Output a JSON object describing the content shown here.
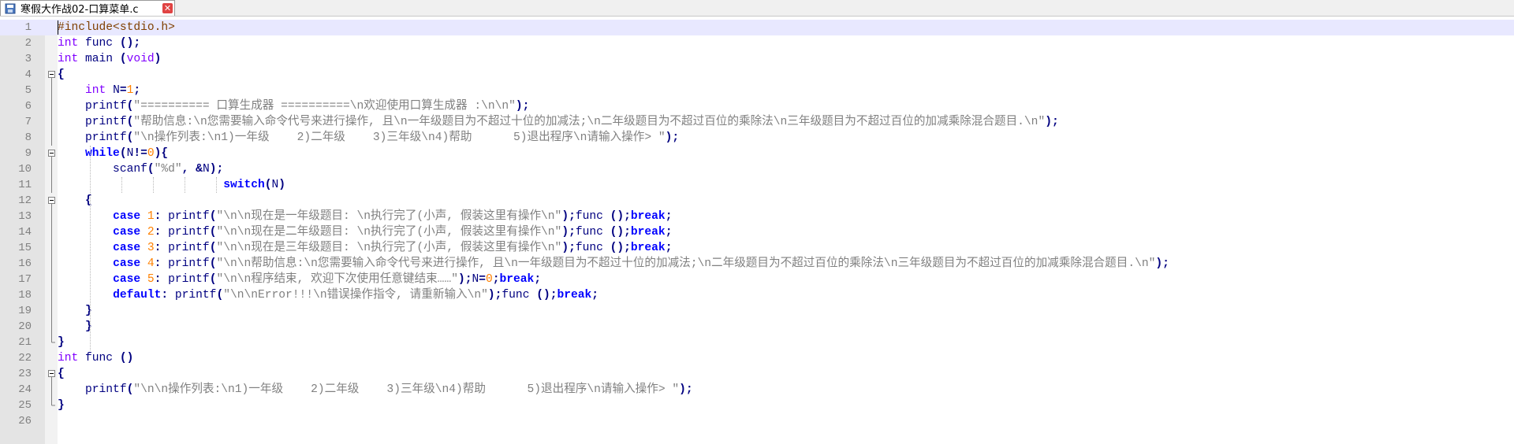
{
  "tab": {
    "title": "寒假大作战02-口算菜单.c",
    "icon": "save-file-icon",
    "close_icon": "close-icon"
  },
  "lines": [
    {
      "n": "1",
      "tokens": [
        {
          "t": "#include<stdio.h>",
          "c": "pp"
        }
      ]
    },
    {
      "n": "2",
      "tokens": [
        {
          "t": "int",
          "c": "ty"
        },
        {
          "t": " func ",
          "c": ""
        },
        {
          "t": "();",
          "c": "op"
        }
      ]
    },
    {
      "n": "3",
      "tokens": [
        {
          "t": "int",
          "c": "ty"
        },
        {
          "t": " main ",
          "c": ""
        },
        {
          "t": "(",
          "c": "op"
        },
        {
          "t": "void",
          "c": "ty"
        },
        {
          "t": ")",
          "c": "op"
        }
      ]
    },
    {
      "n": "4",
      "tokens": [
        {
          "t": "{",
          "c": "op"
        }
      ]
    },
    {
      "n": "5",
      "tokens": [
        {
          "t": "    ",
          "c": ""
        },
        {
          "t": "int",
          "c": "ty"
        },
        {
          "t": " N",
          "c": ""
        },
        {
          "t": "=",
          "c": "op"
        },
        {
          "t": "1",
          "c": "num"
        },
        {
          "t": ";",
          "c": "op"
        }
      ]
    },
    {
      "n": "6",
      "tokens": [
        {
          "t": "    printf",
          "c": ""
        },
        {
          "t": "(",
          "c": "op"
        },
        {
          "t": "\"========== 口算生成器 ==========\\n欢迎使用口算生成器 :\\n\\n\"",
          "c": "str"
        },
        {
          "t": ");",
          "c": "op"
        }
      ]
    },
    {
      "n": "7",
      "tokens": [
        {
          "t": "    printf",
          "c": ""
        },
        {
          "t": "(",
          "c": "op"
        },
        {
          "t": "\"帮助信息:\\n您需要输入命令代号来进行操作, 且\\n一年级题目为不超过十位的加减法;\\n二年级题目为不超过百位的乘除法\\n三年级题目为不超过百位的加减乘除混合题目.\\n\"",
          "c": "str"
        },
        {
          "t": ");",
          "c": "op"
        }
      ]
    },
    {
      "n": "8",
      "tokens": [
        {
          "t": "    printf",
          "c": ""
        },
        {
          "t": "(",
          "c": "op"
        },
        {
          "t": "\"\\n操作列表:\\n1)一年级    2)二年级    3)三年级\\n4)帮助      5)退出程序\\n请输入操作> \"",
          "c": "str"
        },
        {
          "t": ");",
          "c": "op"
        }
      ]
    },
    {
      "n": "9",
      "tokens": [
        {
          "t": "    ",
          "c": ""
        },
        {
          "t": "while",
          "c": "kw"
        },
        {
          "t": "(",
          "c": "op"
        },
        {
          "t": "N",
          "c": ""
        },
        {
          "t": "!=",
          "c": "op"
        },
        {
          "t": "0",
          "c": "num"
        },
        {
          "t": "){",
          "c": "op"
        }
      ]
    },
    {
      "n": "10",
      "tokens": [
        {
          "t": "        scanf",
          "c": ""
        },
        {
          "t": "(",
          "c": "op"
        },
        {
          "t": "\"%d\"",
          "c": "str"
        },
        {
          "t": ", &",
          "c": "op"
        },
        {
          "t": "N",
          "c": ""
        },
        {
          "t": ");",
          "c": "op"
        }
      ]
    },
    {
      "n": "11",
      "tokens": [
        {
          "t": "                        ",
          "c": ""
        },
        {
          "t": "switch",
          "c": "kw"
        },
        {
          "t": "(",
          "c": "op"
        },
        {
          "t": "N",
          "c": ""
        },
        {
          "t": ")",
          "c": "op"
        }
      ]
    },
    {
      "n": "12",
      "tokens": [
        {
          "t": "    ",
          "c": ""
        },
        {
          "t": "{",
          "c": "op"
        }
      ]
    },
    {
      "n": "13",
      "tokens": [
        {
          "t": "        ",
          "c": ""
        },
        {
          "t": "case",
          "c": "kw"
        },
        {
          "t": " ",
          "c": ""
        },
        {
          "t": "1",
          "c": "num"
        },
        {
          "t": ":",
          "c": "op"
        },
        {
          "t": " printf",
          "c": ""
        },
        {
          "t": "(",
          "c": "op"
        },
        {
          "t": "\"\\n\\n现在是一年级题目: \\n执行完了(小声, 假装这里有操作\\n\"",
          "c": "str"
        },
        {
          "t": ");",
          "c": "op"
        },
        {
          "t": "func ",
          "c": ""
        },
        {
          "t": "();",
          "c": "op"
        },
        {
          "t": "break",
          "c": "kw"
        },
        {
          "t": ";",
          "c": "op"
        }
      ]
    },
    {
      "n": "14",
      "tokens": [
        {
          "t": "        ",
          "c": ""
        },
        {
          "t": "case",
          "c": "kw"
        },
        {
          "t": " ",
          "c": ""
        },
        {
          "t": "2",
          "c": "num"
        },
        {
          "t": ":",
          "c": "op"
        },
        {
          "t": " printf",
          "c": ""
        },
        {
          "t": "(",
          "c": "op"
        },
        {
          "t": "\"\\n\\n现在是二年级题目: \\n执行完了(小声, 假装这里有操作\\n\"",
          "c": "str"
        },
        {
          "t": ");",
          "c": "op"
        },
        {
          "t": "func ",
          "c": ""
        },
        {
          "t": "();",
          "c": "op"
        },
        {
          "t": "break",
          "c": "kw"
        },
        {
          "t": ";",
          "c": "op"
        }
      ]
    },
    {
      "n": "15",
      "tokens": [
        {
          "t": "        ",
          "c": ""
        },
        {
          "t": "case",
          "c": "kw"
        },
        {
          "t": " ",
          "c": ""
        },
        {
          "t": "3",
          "c": "num"
        },
        {
          "t": ":",
          "c": "op"
        },
        {
          "t": " printf",
          "c": ""
        },
        {
          "t": "(",
          "c": "op"
        },
        {
          "t": "\"\\n\\n现在是三年级题目: \\n执行完了(小声, 假装这里有操作\\n\"",
          "c": "str"
        },
        {
          "t": ");",
          "c": "op"
        },
        {
          "t": "func ",
          "c": ""
        },
        {
          "t": "();",
          "c": "op"
        },
        {
          "t": "break",
          "c": "kw"
        },
        {
          "t": ";",
          "c": "op"
        }
      ]
    },
    {
      "n": "16",
      "tokens": [
        {
          "t": "        ",
          "c": ""
        },
        {
          "t": "case",
          "c": "kw"
        },
        {
          "t": " ",
          "c": ""
        },
        {
          "t": "4",
          "c": "num"
        },
        {
          "t": ":",
          "c": "op"
        },
        {
          "t": " printf",
          "c": ""
        },
        {
          "t": "(",
          "c": "op"
        },
        {
          "t": "\"\\n\\n帮助信息:\\n您需要输入命令代号来进行操作, 且\\n一年级题目为不超过十位的加减法;\\n二年级题目为不超过百位的乘除法\\n三年级题目为不超过百位的加减乘除混合题目.\\n\"",
          "c": "str"
        },
        {
          "t": ");",
          "c": "op"
        }
      ]
    },
    {
      "n": "17",
      "tokens": [
        {
          "t": "        ",
          "c": ""
        },
        {
          "t": "case",
          "c": "kw"
        },
        {
          "t": " ",
          "c": ""
        },
        {
          "t": "5",
          "c": "num"
        },
        {
          "t": ":",
          "c": "op"
        },
        {
          "t": " printf",
          "c": ""
        },
        {
          "t": "(",
          "c": "op"
        },
        {
          "t": "\"\\n\\n程序结束, 欢迎下次使用任意键结束……\"",
          "c": "str"
        },
        {
          "t": ");",
          "c": "op"
        },
        {
          "t": "N",
          "c": ""
        },
        {
          "t": "=",
          "c": "op"
        },
        {
          "t": "0",
          "c": "num"
        },
        {
          "t": ";",
          "c": "op"
        },
        {
          "t": "break",
          "c": "kw"
        },
        {
          "t": ";",
          "c": "op"
        }
      ]
    },
    {
      "n": "18",
      "tokens": [
        {
          "t": "        ",
          "c": ""
        },
        {
          "t": "default",
          "c": "kw"
        },
        {
          "t": ":",
          "c": "op"
        },
        {
          "t": " printf",
          "c": ""
        },
        {
          "t": "(",
          "c": "op"
        },
        {
          "t": "\"\\n\\nError!!!\\n错误操作指令, 请重新输入\\n\"",
          "c": "str"
        },
        {
          "t": ");",
          "c": "op"
        },
        {
          "t": "func ",
          "c": ""
        },
        {
          "t": "();",
          "c": "op"
        },
        {
          "t": "break",
          "c": "kw"
        },
        {
          "t": ";",
          "c": "op"
        }
      ]
    },
    {
      "n": "19",
      "tokens": [
        {
          "t": "    ",
          "c": ""
        },
        {
          "t": "}",
          "c": "op"
        }
      ]
    },
    {
      "n": "20",
      "tokens": [
        {
          "t": "    ",
          "c": ""
        },
        {
          "t": "}",
          "c": "op"
        }
      ]
    },
    {
      "n": "21",
      "tokens": [
        {
          "t": "}",
          "c": "op"
        }
      ]
    },
    {
      "n": "22",
      "tokens": [
        {
          "t": "int",
          "c": "ty"
        },
        {
          "t": " func ",
          "c": ""
        },
        {
          "t": "()",
          "c": "op"
        }
      ]
    },
    {
      "n": "23",
      "tokens": [
        {
          "t": "{",
          "c": "op"
        }
      ]
    },
    {
      "n": "24",
      "tokens": [
        {
          "t": "    printf",
          "c": ""
        },
        {
          "t": "(",
          "c": "op"
        },
        {
          "t": "\"\\n\\n操作列表:\\n1)一年级    2)二年级    3)三年级\\n4)帮助      5)退出程序\\n请输入操作> \"",
          "c": "str"
        },
        {
          "t": ");",
          "c": "op"
        }
      ]
    },
    {
      "n": "25",
      "tokens": [
        {
          "t": "}",
          "c": "op"
        }
      ]
    },
    {
      "n": "26",
      "tokens": []
    }
  ],
  "folds": {
    "4": "open",
    "5": "line",
    "6": "line",
    "7": "line",
    "8": "line",
    "9": "open",
    "10": "line",
    "11": "line",
    "12": "open",
    "13": "line",
    "14": "line",
    "15": "line",
    "16": "line",
    "17": "line",
    "18": "line",
    "19": "line",
    "20": "line",
    "21": "end",
    "23": "open",
    "24": "line",
    "25": "end"
  }
}
